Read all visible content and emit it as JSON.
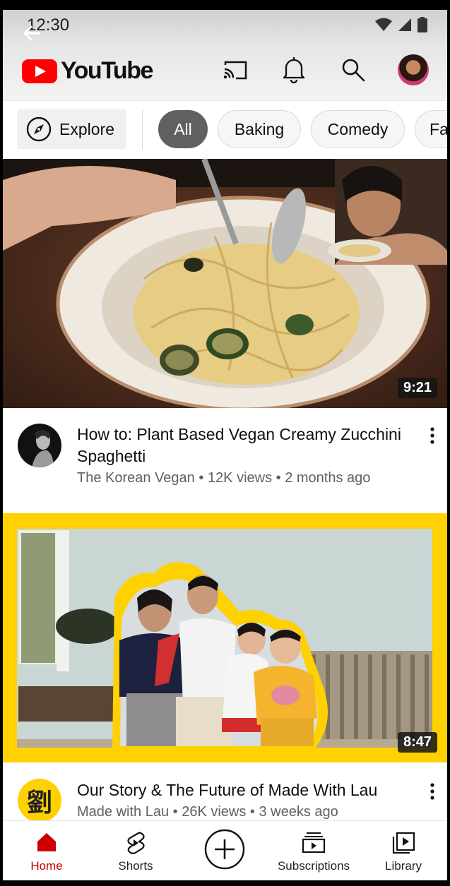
{
  "status_bar": {
    "time": "12:30"
  },
  "header": {
    "app_name": "YouTube",
    "brand_color": "#ff0000"
  },
  "chips": {
    "explore_label": "Explore",
    "items": [
      {
        "label": "All",
        "active": true
      },
      {
        "label": "Baking",
        "active": false
      },
      {
        "label": "Comedy",
        "active": false
      },
      {
        "label": "Fa",
        "active": false
      }
    ]
  },
  "feed": {
    "videos": [
      {
        "duration": "9:21",
        "title": "How to: Plant Based Vegan Creamy Zucchini Spaghetti",
        "channel": "The Korean Vegan",
        "views": "12K views",
        "age": "2 months ago"
      },
      {
        "duration": "8:47",
        "title": "Our Story & The Future of Made With Lau",
        "channel": "Made with Lau",
        "views": "26K views",
        "age": "3 weeks ago",
        "avatar_char": "劉"
      }
    ]
  },
  "bottom_nav": {
    "items": [
      {
        "label": "Home",
        "active": true
      },
      {
        "label": "Shorts",
        "active": false
      },
      {
        "label": "Subscriptions",
        "active": false
      },
      {
        "label": "Library",
        "active": false
      }
    ],
    "accent_color": "#cc0000"
  }
}
